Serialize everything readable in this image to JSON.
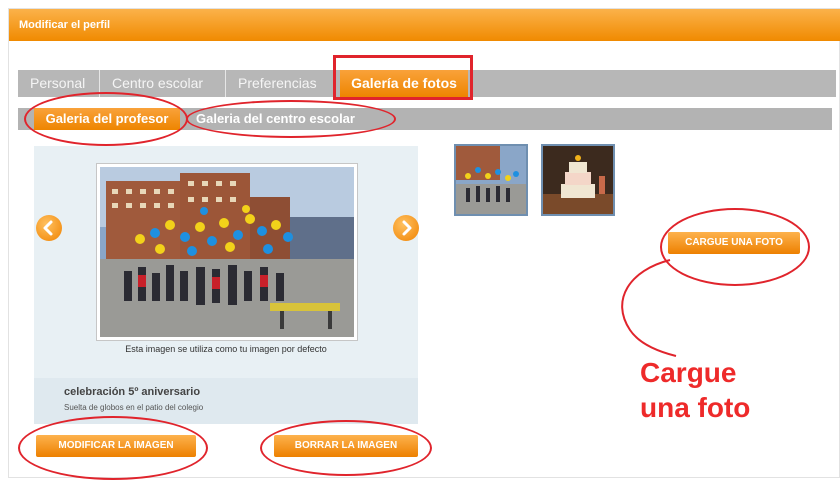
{
  "header": {
    "title": "Modificar el perfil"
  },
  "tabs": [
    {
      "label": "Personal"
    },
    {
      "label": "Centro escolar"
    },
    {
      "label": "Preferencias"
    },
    {
      "label": "Galería de fotos",
      "active": true
    }
  ],
  "subtabs": [
    {
      "label": "Galeria del profesor",
      "active": true
    },
    {
      "label": "Galeria del centro escolar"
    }
  ],
  "viewer": {
    "caption": "Esta imagen se utiliza como tu imagen por defecto",
    "image_title": "celebración 5º aniversario",
    "image_desc": "Suelta de globos en el patio del colegio"
  },
  "buttons": {
    "modify": "MODIFICAR LA IMAGEN",
    "delete": "BORRAR LA IMAGEN",
    "upload": "CARGUE UNA FOTO"
  },
  "callout": {
    "line1": "Cargue",
    "line2": "una foto"
  },
  "colors": {
    "accent": "#f08a00",
    "annotation": "#e0242c",
    "tab_grey": "#b7b7b7"
  },
  "icons": {
    "prev": "arrow-left-icon",
    "next": "arrow-right-icon"
  }
}
